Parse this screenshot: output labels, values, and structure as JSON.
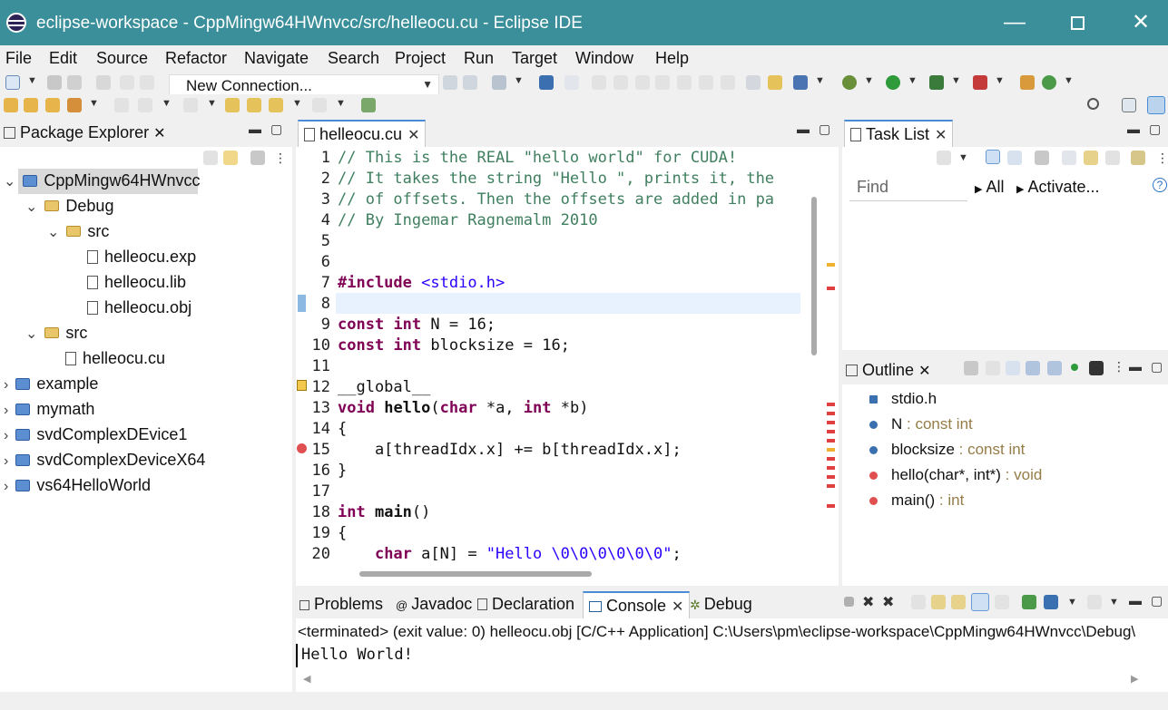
{
  "window": {
    "title": "eclipse-workspace - CppMingw64HWnvcc/src/helleocu.cu - Eclipse IDE",
    "min_glyph": "—",
    "close_glyph": "✕"
  },
  "menu": [
    "File",
    "Edit",
    "Source",
    "Refactor",
    "Navigate",
    "Search",
    "Project",
    "Run",
    "Target",
    "Window",
    "Help"
  ],
  "toolbar": {
    "connection_value": "New Connection..."
  },
  "package_explorer": {
    "tab_label": "Package Explorer",
    "tree": [
      {
        "label": "CppMingw64HWnvcc",
        "level": 0,
        "kind": "project",
        "expanded": true,
        "selected": true
      },
      {
        "label": "Debug",
        "level": 1,
        "kind": "folder",
        "expanded": true
      },
      {
        "label": "src",
        "level": 2,
        "kind": "folder",
        "expanded": true
      },
      {
        "label": "helleocu.exp",
        "level": 3,
        "kind": "file"
      },
      {
        "label": "helleocu.lib",
        "level": 3,
        "kind": "file"
      },
      {
        "label": "helleocu.obj",
        "level": 3,
        "kind": "file"
      },
      {
        "label": "src",
        "level": 1,
        "kind": "folder",
        "expanded": true
      },
      {
        "label": "helleocu.cu",
        "level": 2,
        "kind": "file"
      },
      {
        "label": "example",
        "level": 0,
        "kind": "project",
        "expanded": false
      },
      {
        "label": "mymath",
        "level": 0,
        "kind": "project",
        "expanded": false
      },
      {
        "label": "svdComplexDEvice1",
        "level": 0,
        "kind": "project",
        "expanded": false
      },
      {
        "label": "svdComplexDeviceX64",
        "level": 0,
        "kind": "project",
        "expanded": false
      },
      {
        "label": "vs64HelloWorld",
        "level": 0,
        "kind": "project",
        "expanded": false
      }
    ]
  },
  "editor": {
    "tab_label": "helleocu.cu",
    "lines": [
      "// This is the REAL \"hello world\" for CUDA!",
      "// It takes the string \"Hello \", prints it, the",
      "// of offsets. Then the offsets are added in pa",
      "// By Ingemar Ragnemalm 2010",
      "",
      "",
      "#include <stdio.h>",
      "",
      "const int N = 16;",
      "const int blocksize = 16;",
      "",
      "__global__",
      "void hello(char *a, int *b)",
      "{",
      "    a[threadIdx.x] += b[threadIdx.x];",
      "}",
      "",
      "int main()",
      "{",
      "    char a[N] = \"Hello \\0\\0\\0\\0\\0\\0\";"
    ]
  },
  "task_list": {
    "tab_label": "Task List",
    "find_placeholder": "Find",
    "all_label": "All",
    "activate_label": "Activate..."
  },
  "outline": {
    "tab_label": "Outline",
    "items": [
      {
        "name": "stdio.h",
        "type": "",
        "icon": "include-icon"
      },
      {
        "name": "N",
        "type": " : const int",
        "icon": "variable-icon"
      },
      {
        "name": "blocksize",
        "type": " : const int",
        "icon": "variable-icon"
      },
      {
        "name": "hello(char*, int*)",
        "type": " : void",
        "icon": "function-icon"
      },
      {
        "name": "main()",
        "type": " : int",
        "icon": "function-icon"
      }
    ]
  },
  "bottom_tabs": {
    "problems": "Problems",
    "javadoc": "Javadoc",
    "declaration": "Declaration",
    "console": "Console",
    "debug": "Debug"
  },
  "console": {
    "header": "<terminated> (exit value: 0) helleocu.obj [C/C++ Application] C:\\Users\\pm\\eclipse-workspace\\CppMingw64HWnvcc\\Debug\\",
    "output": "Hello World!"
  },
  "colors": {
    "titlebar": "#3a8f9a",
    "tab_accent": "#4a8bd6",
    "comment": "#3f7f5f",
    "keyword": "#7f0055",
    "string": "#2a00ff"
  }
}
